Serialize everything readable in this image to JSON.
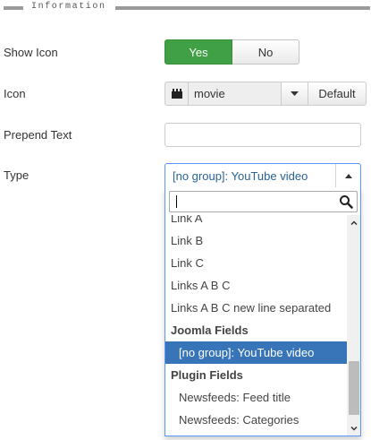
{
  "section": {
    "title": "Information"
  },
  "fields": {
    "show_icon": {
      "label": "Show Icon",
      "yes_label": "Yes",
      "no_label": "No",
      "selected": "Yes"
    },
    "icon": {
      "label": "Icon",
      "value": "movie",
      "default_label": "Default",
      "icon_name": "film-icon"
    },
    "prepend_text": {
      "label": "Prepend Text",
      "value": ""
    },
    "type": {
      "label": "Type",
      "selected": "[no group]: YouTube video",
      "search_value": "",
      "results": [
        {
          "kind": "option",
          "text": "Link A"
        },
        {
          "kind": "option",
          "text": "Link B"
        },
        {
          "kind": "option",
          "text": "Link C"
        },
        {
          "kind": "option",
          "text": "Links A B C"
        },
        {
          "kind": "option",
          "text": "Links A B C new line separated"
        },
        {
          "kind": "group",
          "text": "Joomla Fields"
        },
        {
          "kind": "suboption",
          "text": "[no group]: YouTube video",
          "highlighted": true
        },
        {
          "kind": "group",
          "text": "Plugin Fields"
        },
        {
          "kind": "suboption",
          "text": "Newsfeeds: Feed title"
        },
        {
          "kind": "suboption",
          "text": "Newsfeeds: Categories"
        }
      ]
    }
  },
  "colors": {
    "yes_active": "#3fa045",
    "highlight": "#3875b8",
    "chosen_border": "#5897fb",
    "selected_text": "#2a6496"
  }
}
